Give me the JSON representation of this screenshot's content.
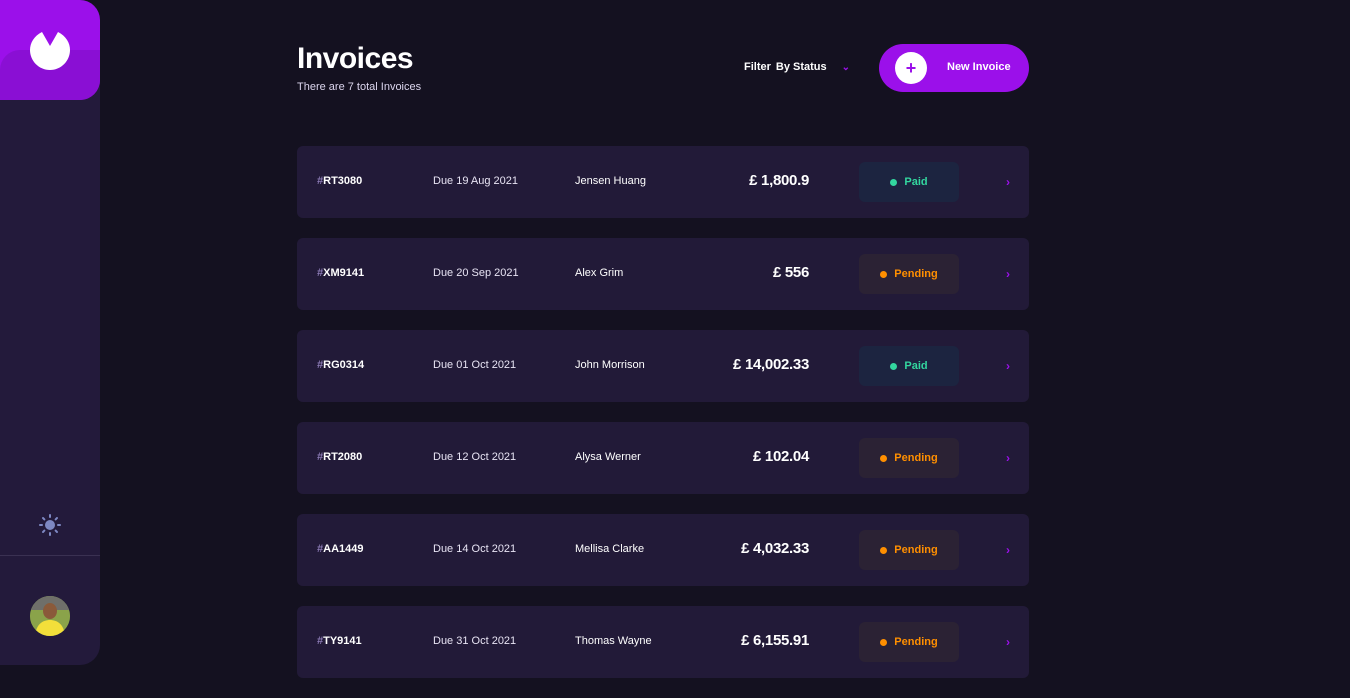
{
  "header": {
    "title": "Invoices",
    "subtitle": "There are 7 total Invoices",
    "filter_label": "Filter",
    "filter_value": "By Status",
    "new_invoice_label": "New Invoice"
  },
  "colors": {
    "accent": "#9b10ea",
    "paid": "#33d69f",
    "pending": "#ff8f00"
  },
  "invoices": [
    {
      "hash": "#",
      "id": "RT3080",
      "due": "Due 19 Aug 2021",
      "client": "Jensen Huang",
      "amount": "£ 1,800.9",
      "status": "Paid"
    },
    {
      "hash": "#",
      "id": "XM9141",
      "due": "Due 20 Sep 2021",
      "client": "Alex Grim",
      "amount": "£ 556",
      "status": "Pending"
    },
    {
      "hash": "#",
      "id": "RG0314",
      "due": "Due 01 Oct 2021",
      "client": "John Morrison",
      "amount": "£ 14,002.33",
      "status": "Paid"
    },
    {
      "hash": "#",
      "id": "RT2080",
      "due": "Due 12 Oct 2021",
      "client": "Alysa Werner",
      "amount": "£ 102.04",
      "status": "Pending"
    },
    {
      "hash": "#",
      "id": "AA1449",
      "due": "Due 14 Oct 2021",
      "client": "Mellisa Clarke",
      "amount": "£ 4,032.33",
      "status": "Pending"
    },
    {
      "hash": "#",
      "id": "TY9141",
      "due": "Due 31 Oct 2021",
      "client": "Thomas Wayne",
      "amount": "£ 6,155.91",
      "status": "Pending"
    }
  ]
}
